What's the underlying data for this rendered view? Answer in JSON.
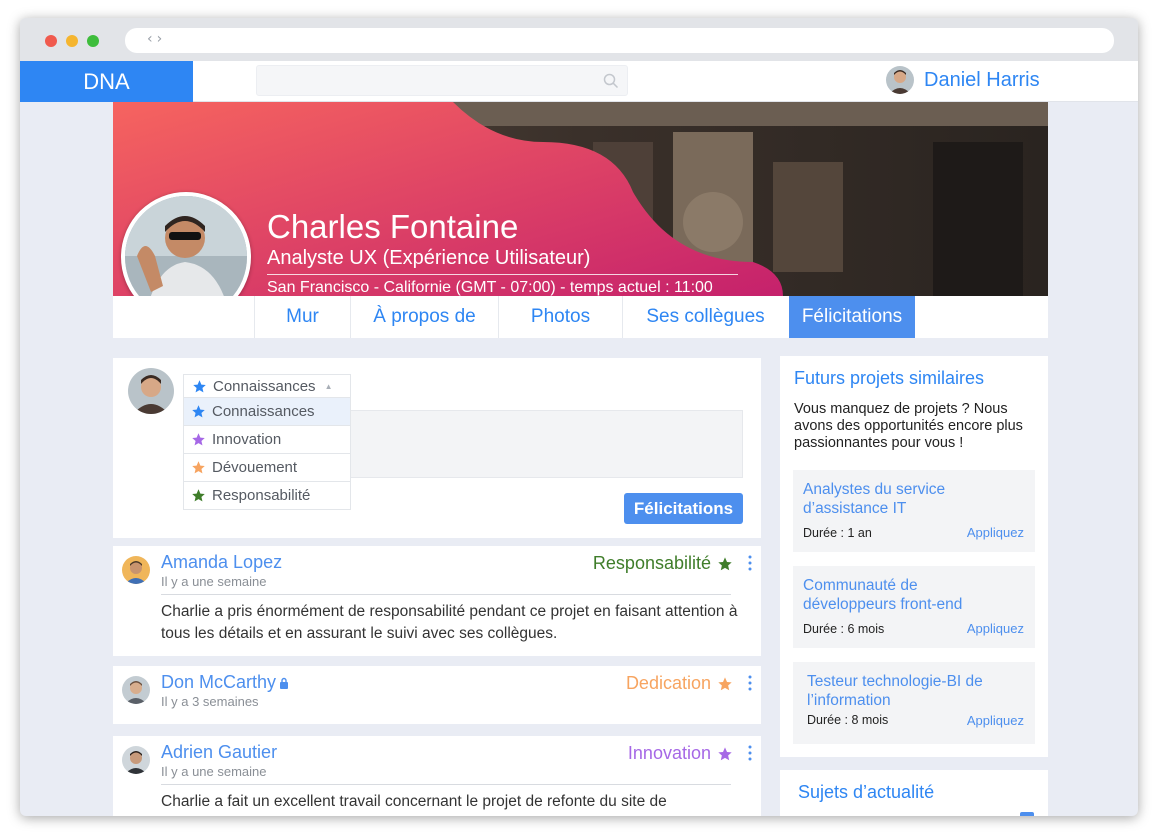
{
  "app": {
    "logo": "DNA"
  },
  "user": {
    "name": "Daniel Harris"
  },
  "profile": {
    "name": "Charles Fontaine",
    "role": "Analyste UX (Expérience Utilisateur)",
    "location": "San Francisco - Californie (GMT - 07:00) - temps actuel : 11:00"
  },
  "tabs": [
    {
      "label": "Mur"
    },
    {
      "label": "À propos de"
    },
    {
      "label": "Photos"
    },
    {
      "label": "Ses collègues"
    },
    {
      "label": "Félicitations"
    }
  ],
  "composer": {
    "dropdown": {
      "selected": "Connaissances",
      "options": [
        {
          "label": "Connaissances",
          "color": "#2e86f3"
        },
        {
          "label": "Innovation",
          "color": "#a668e6"
        },
        {
          "label": "Dévouement",
          "color": "#f7a460"
        },
        {
          "label": "Responsabilité",
          "color": "#3f7d2a"
        }
      ]
    },
    "submit_label": "Félicitations"
  },
  "posts": [
    {
      "author": "Amanda Lopez",
      "time": "Il y a une semaine",
      "badge": "Responsabilité",
      "badge_color": "#3f7d2a",
      "body": "Charlie a pris énormément de responsabilité pendant ce projet en faisant attention à tous les détails et en assurant le suivi avec ses collègues."
    },
    {
      "author": "Don McCarthy",
      "time": "Il y a 3 semaines",
      "badge": "Dedication",
      "badge_color": "#f7a460"
    },
    {
      "author": "Adrien Gautier",
      "time": "Il y a une semaine",
      "badge": "Innovation",
      "badge_color": "#a668e6",
      "body": "Charlie a fait un excellent travail concernant le projet de refonte du site de"
    }
  ],
  "sidebar": {
    "title": "Futurs projets similaires",
    "desc": "Vous manquez de projets ? Nous avons des opportunités encore plus passionnantes pour vous !",
    "projects": [
      {
        "title": "Analystes du service d’assistance IT",
        "duration": "Durée : 1 an",
        "apply": "Appliquez"
      },
      {
        "title": "Communauté de développeurs front-end",
        "duration": "Durée : 6 mois",
        "apply": "Appliquez"
      },
      {
        "title": "Testeur technologie-BI de l’information",
        "duration": "Durée : 8 mois",
        "apply": "Appliquez"
      }
    ],
    "news_title": "Sujets d’actualité"
  },
  "colors": {
    "accent": "#2e86f3",
    "button": "#4d8fee",
    "banner_from": "#f6645f",
    "banner_to": "#c5216c"
  }
}
